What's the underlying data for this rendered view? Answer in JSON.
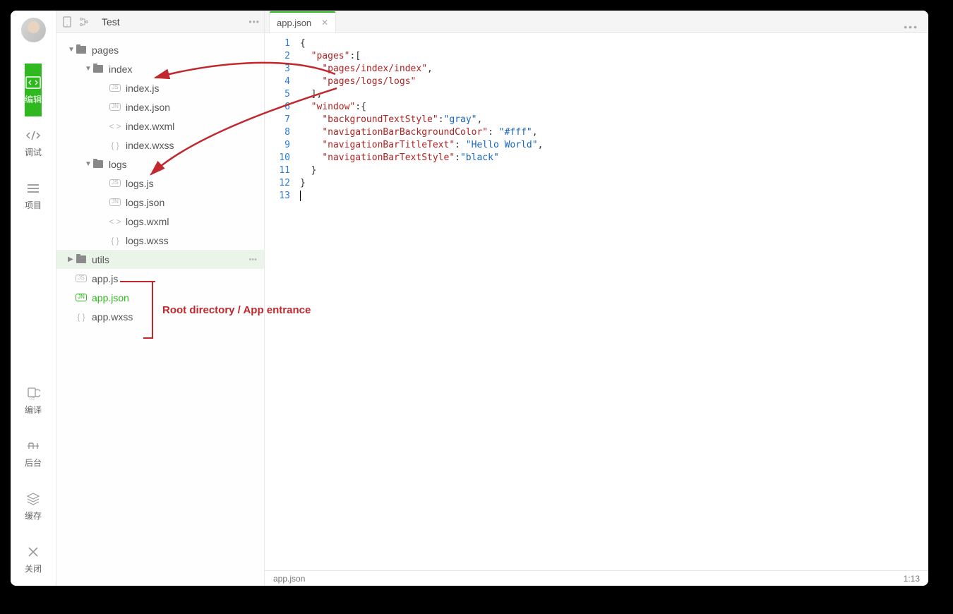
{
  "sidebar": {
    "items": [
      {
        "label": "编辑",
        "active": true
      },
      {
        "label": "调试",
        "active": false
      },
      {
        "label": "项目",
        "active": false
      }
    ],
    "bottom_items": [
      {
        "label": "编译"
      },
      {
        "label": "后台"
      },
      {
        "label": "缓存"
      },
      {
        "label": "关闭"
      }
    ]
  },
  "explorer": {
    "title": "Test",
    "tree": [
      {
        "kind": "folder",
        "name": "pages",
        "depth": 0,
        "open": true,
        "arrow": "▼"
      },
      {
        "kind": "folder",
        "name": "index",
        "depth": 1,
        "open": true,
        "arrow": "▼"
      },
      {
        "kind": "file",
        "name": "index.js",
        "depth": 2,
        "icon": "js"
      },
      {
        "kind": "file",
        "name": "index.json",
        "depth": 2,
        "icon": "jn"
      },
      {
        "kind": "file",
        "name": "index.wxml",
        "depth": 2,
        "icon": "tag"
      },
      {
        "kind": "file",
        "name": "index.wxss",
        "depth": 2,
        "icon": "braces"
      },
      {
        "kind": "folder",
        "name": "logs",
        "depth": 1,
        "open": true,
        "arrow": "▼"
      },
      {
        "kind": "file",
        "name": "logs.js",
        "depth": 2,
        "icon": "js"
      },
      {
        "kind": "file",
        "name": "logs.json",
        "depth": 2,
        "icon": "jn"
      },
      {
        "kind": "file",
        "name": "logs.wxml",
        "depth": 2,
        "icon": "tag"
      },
      {
        "kind": "file",
        "name": "logs.wxss",
        "depth": 2,
        "icon": "braces"
      },
      {
        "kind": "folder",
        "name": "utils",
        "depth": 0,
        "open": false,
        "arrow": "▶",
        "selected": true
      },
      {
        "kind": "file",
        "name": "app.js",
        "depth": 0,
        "icon": "js"
      },
      {
        "kind": "file",
        "name": "app.json",
        "depth": 0,
        "icon": "jn",
        "active": true
      },
      {
        "kind": "file",
        "name": "app.wxss",
        "depth": 0,
        "icon": "braces"
      }
    ]
  },
  "editor": {
    "tab": "app.json",
    "code_lines": [
      [
        {
          "t": "{",
          "c": "p"
        }
      ],
      [
        {
          "t": "  ",
          "c": "p"
        },
        {
          "t": "\"pages\"",
          "c": "k"
        },
        {
          "t": ":[",
          "c": "p"
        }
      ],
      [
        {
          "t": "    ",
          "c": "p"
        },
        {
          "t": "\"pages/index/index\"",
          "c": "k"
        },
        {
          "t": ",",
          "c": "p"
        }
      ],
      [
        {
          "t": "    ",
          "c": "p"
        },
        {
          "t": "\"pages/logs/logs\"",
          "c": "k"
        }
      ],
      [
        {
          "t": "  ],",
          "c": "p"
        }
      ],
      [
        {
          "t": "  ",
          "c": "p"
        },
        {
          "t": "\"window\"",
          "c": "k"
        },
        {
          "t": ":{",
          "c": "p"
        }
      ],
      [
        {
          "t": "    ",
          "c": "p"
        },
        {
          "t": "\"backgroundTextStyle\"",
          "c": "k"
        },
        {
          "t": ":",
          "c": "p"
        },
        {
          "t": "\"gray\"",
          "c": "s"
        },
        {
          "t": ",",
          "c": "p"
        }
      ],
      [
        {
          "t": "    ",
          "c": "p"
        },
        {
          "t": "\"navigationBarBackgroundColor\"",
          "c": "k"
        },
        {
          "t": ": ",
          "c": "p"
        },
        {
          "t": "\"#fff\"",
          "c": "s"
        },
        {
          "t": ",",
          "c": "p"
        }
      ],
      [
        {
          "t": "    ",
          "c": "p"
        },
        {
          "t": "\"navigationBarTitleText\"",
          "c": "k"
        },
        {
          "t": ": ",
          "c": "p"
        },
        {
          "t": "\"Hello World\"",
          "c": "s"
        },
        {
          "t": ",",
          "c": "p"
        }
      ],
      [
        {
          "t": "    ",
          "c": "p"
        },
        {
          "t": "\"navigationBarTextStyle\"",
          "c": "k"
        },
        {
          "t": ":",
          "c": "p"
        },
        {
          "t": "\"black\"",
          "c": "s"
        }
      ],
      [
        {
          "t": "  }",
          "c": "p"
        }
      ],
      [
        {
          "t": "}",
          "c": "p"
        }
      ],
      [
        {
          "t": "",
          "c": "p"
        }
      ]
    ],
    "status_file": "app.json",
    "status_pos": "1:13"
  },
  "annotation": {
    "label": "Root directory / App entrance"
  }
}
